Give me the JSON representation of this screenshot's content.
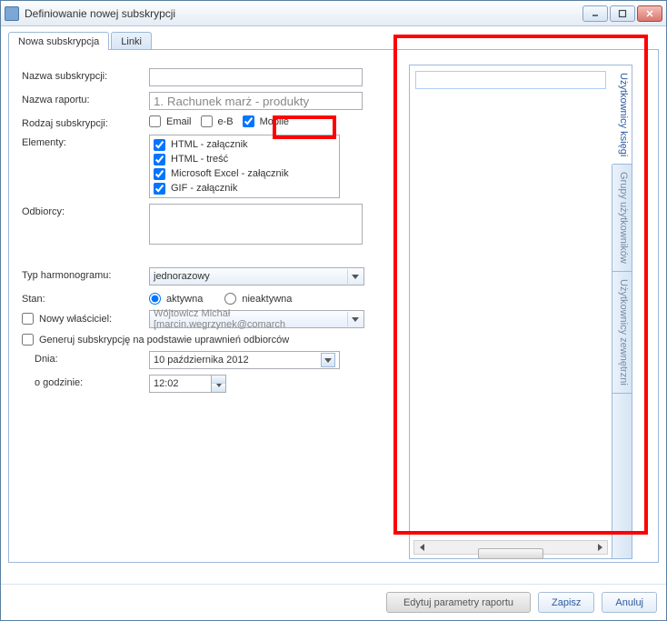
{
  "window": {
    "title": "Definiowanie nowej subskrypcji"
  },
  "tabs": {
    "t0": "Nowa subskrypcja",
    "t1": "Linki"
  },
  "form": {
    "name_lbl": "Nazwa subskrypcji:",
    "name_val": "",
    "report_lbl": "Nazwa raportu:",
    "report_val": "1. Rachunek marż - produkty",
    "type_lbl": "Rodzaj subskrypcji:",
    "type_opts": {
      "email": "Email",
      "eb": "e-B",
      "mobile": "Mobile"
    },
    "type_checked": {
      "email": false,
      "eb": false,
      "mobile": true
    },
    "elements_lbl": "Elementy:",
    "elements": [
      {
        "label": "HTML - załącznik",
        "checked": true
      },
      {
        "label": "HTML - treść",
        "checked": true
      },
      {
        "label": "Microsoft Excel - załącznik",
        "checked": true
      },
      {
        "label": "GIF - załącznik",
        "checked": true
      }
    ],
    "recipients_lbl": "Odbiorcy:",
    "recipients_val": "",
    "schedule_lbl": "Typ harmonogramu:",
    "schedule_val": "jednorazowy",
    "state_lbl": "Stan:",
    "state_opts": {
      "active": "aktywna",
      "inactive": "nieaktywna"
    },
    "state_sel": "active",
    "newowner_lbl": "Nowy właściciel:",
    "newowner_checked": false,
    "newowner_val": "Wójtowicz Michał [marcin.wegrzynek@comarch",
    "genperm_lbl": "Generuj subskrypcję na podstawie uprawnień odbiorców",
    "genperm_checked": false,
    "date_lbl": "Dnia:",
    "date_val": "10 października 2012",
    "time_lbl": "o godzinie:",
    "time_val": "12:02"
  },
  "right_tabs": {
    "t0": "Użytkownicy księgi",
    "t1": "Grupy użytkowników",
    "t2": "Użytkownicy zewnętrzni"
  },
  "footer": {
    "edit": "Edytuj parametry raportu",
    "save": "Zapisz",
    "cancel": "Anuluj"
  }
}
